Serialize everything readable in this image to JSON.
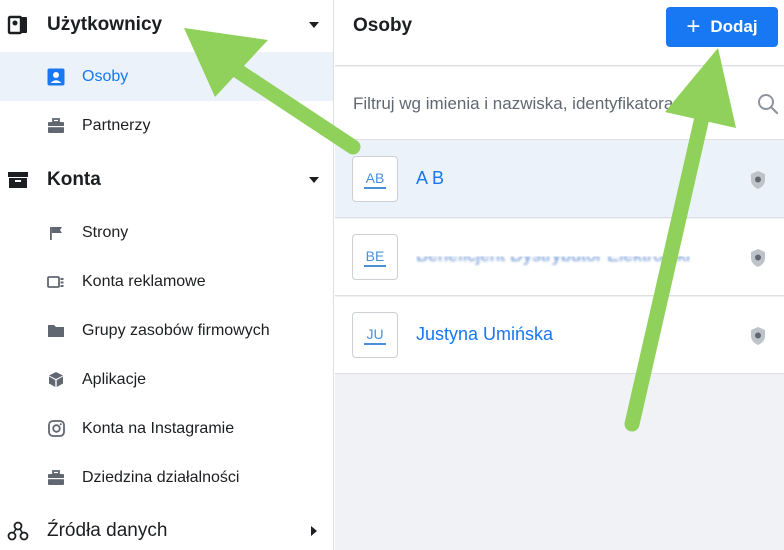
{
  "sidebar": {
    "sections": [
      {
        "label": "Użytkownicy",
        "icon": "users-icon",
        "expanded": true
      },
      {
        "label": "Konta",
        "icon": "inbox-icon",
        "expanded": true
      },
      {
        "label": "Źródła danych",
        "icon": "data-sources-icon",
        "expanded": false
      }
    ],
    "users_items": [
      {
        "label": "Osoby",
        "icon": "person-icon",
        "active": true
      },
      {
        "label": "Partnerzy",
        "icon": "briefcase-icon",
        "active": false
      }
    ],
    "accounts_items": [
      {
        "label": "Strony",
        "icon": "flag-icon"
      },
      {
        "label": "Konta reklamowe",
        "icon": "ad-account-icon"
      },
      {
        "label": "Grupy zasobów firmowych",
        "icon": "folder-icon"
      },
      {
        "label": "Aplikacje",
        "icon": "cube-icon"
      },
      {
        "label": "Konta na Instagramie",
        "icon": "instagram-icon"
      },
      {
        "label": "Dziedzina działalności",
        "icon": "briefcase-icon"
      }
    ]
  },
  "main": {
    "title": "Osoby",
    "add_button": {
      "label": "Dodaj",
      "icon": "plus-icon"
    },
    "search": {
      "placeholder": "Filtruj wg imienia i nazwiska, identyfikatora",
      "icon": "search-icon"
    },
    "people": [
      {
        "initials": "AB",
        "name": "A B",
        "selected": true,
        "obscured": false
      },
      {
        "initials": "BE",
        "name": "Beneficjent Dystrybutor Elektroniki",
        "selected": false,
        "obscured": true
      },
      {
        "initials": "JU",
        "name": "Justyna Umińska",
        "selected": false,
        "obscured": false
      }
    ]
  },
  "colors": {
    "accent": "#1877f2",
    "active_bg": "#ebf2fa",
    "main_bg": "#f0f2f5",
    "annotation_arrow": "#8fd15a"
  }
}
